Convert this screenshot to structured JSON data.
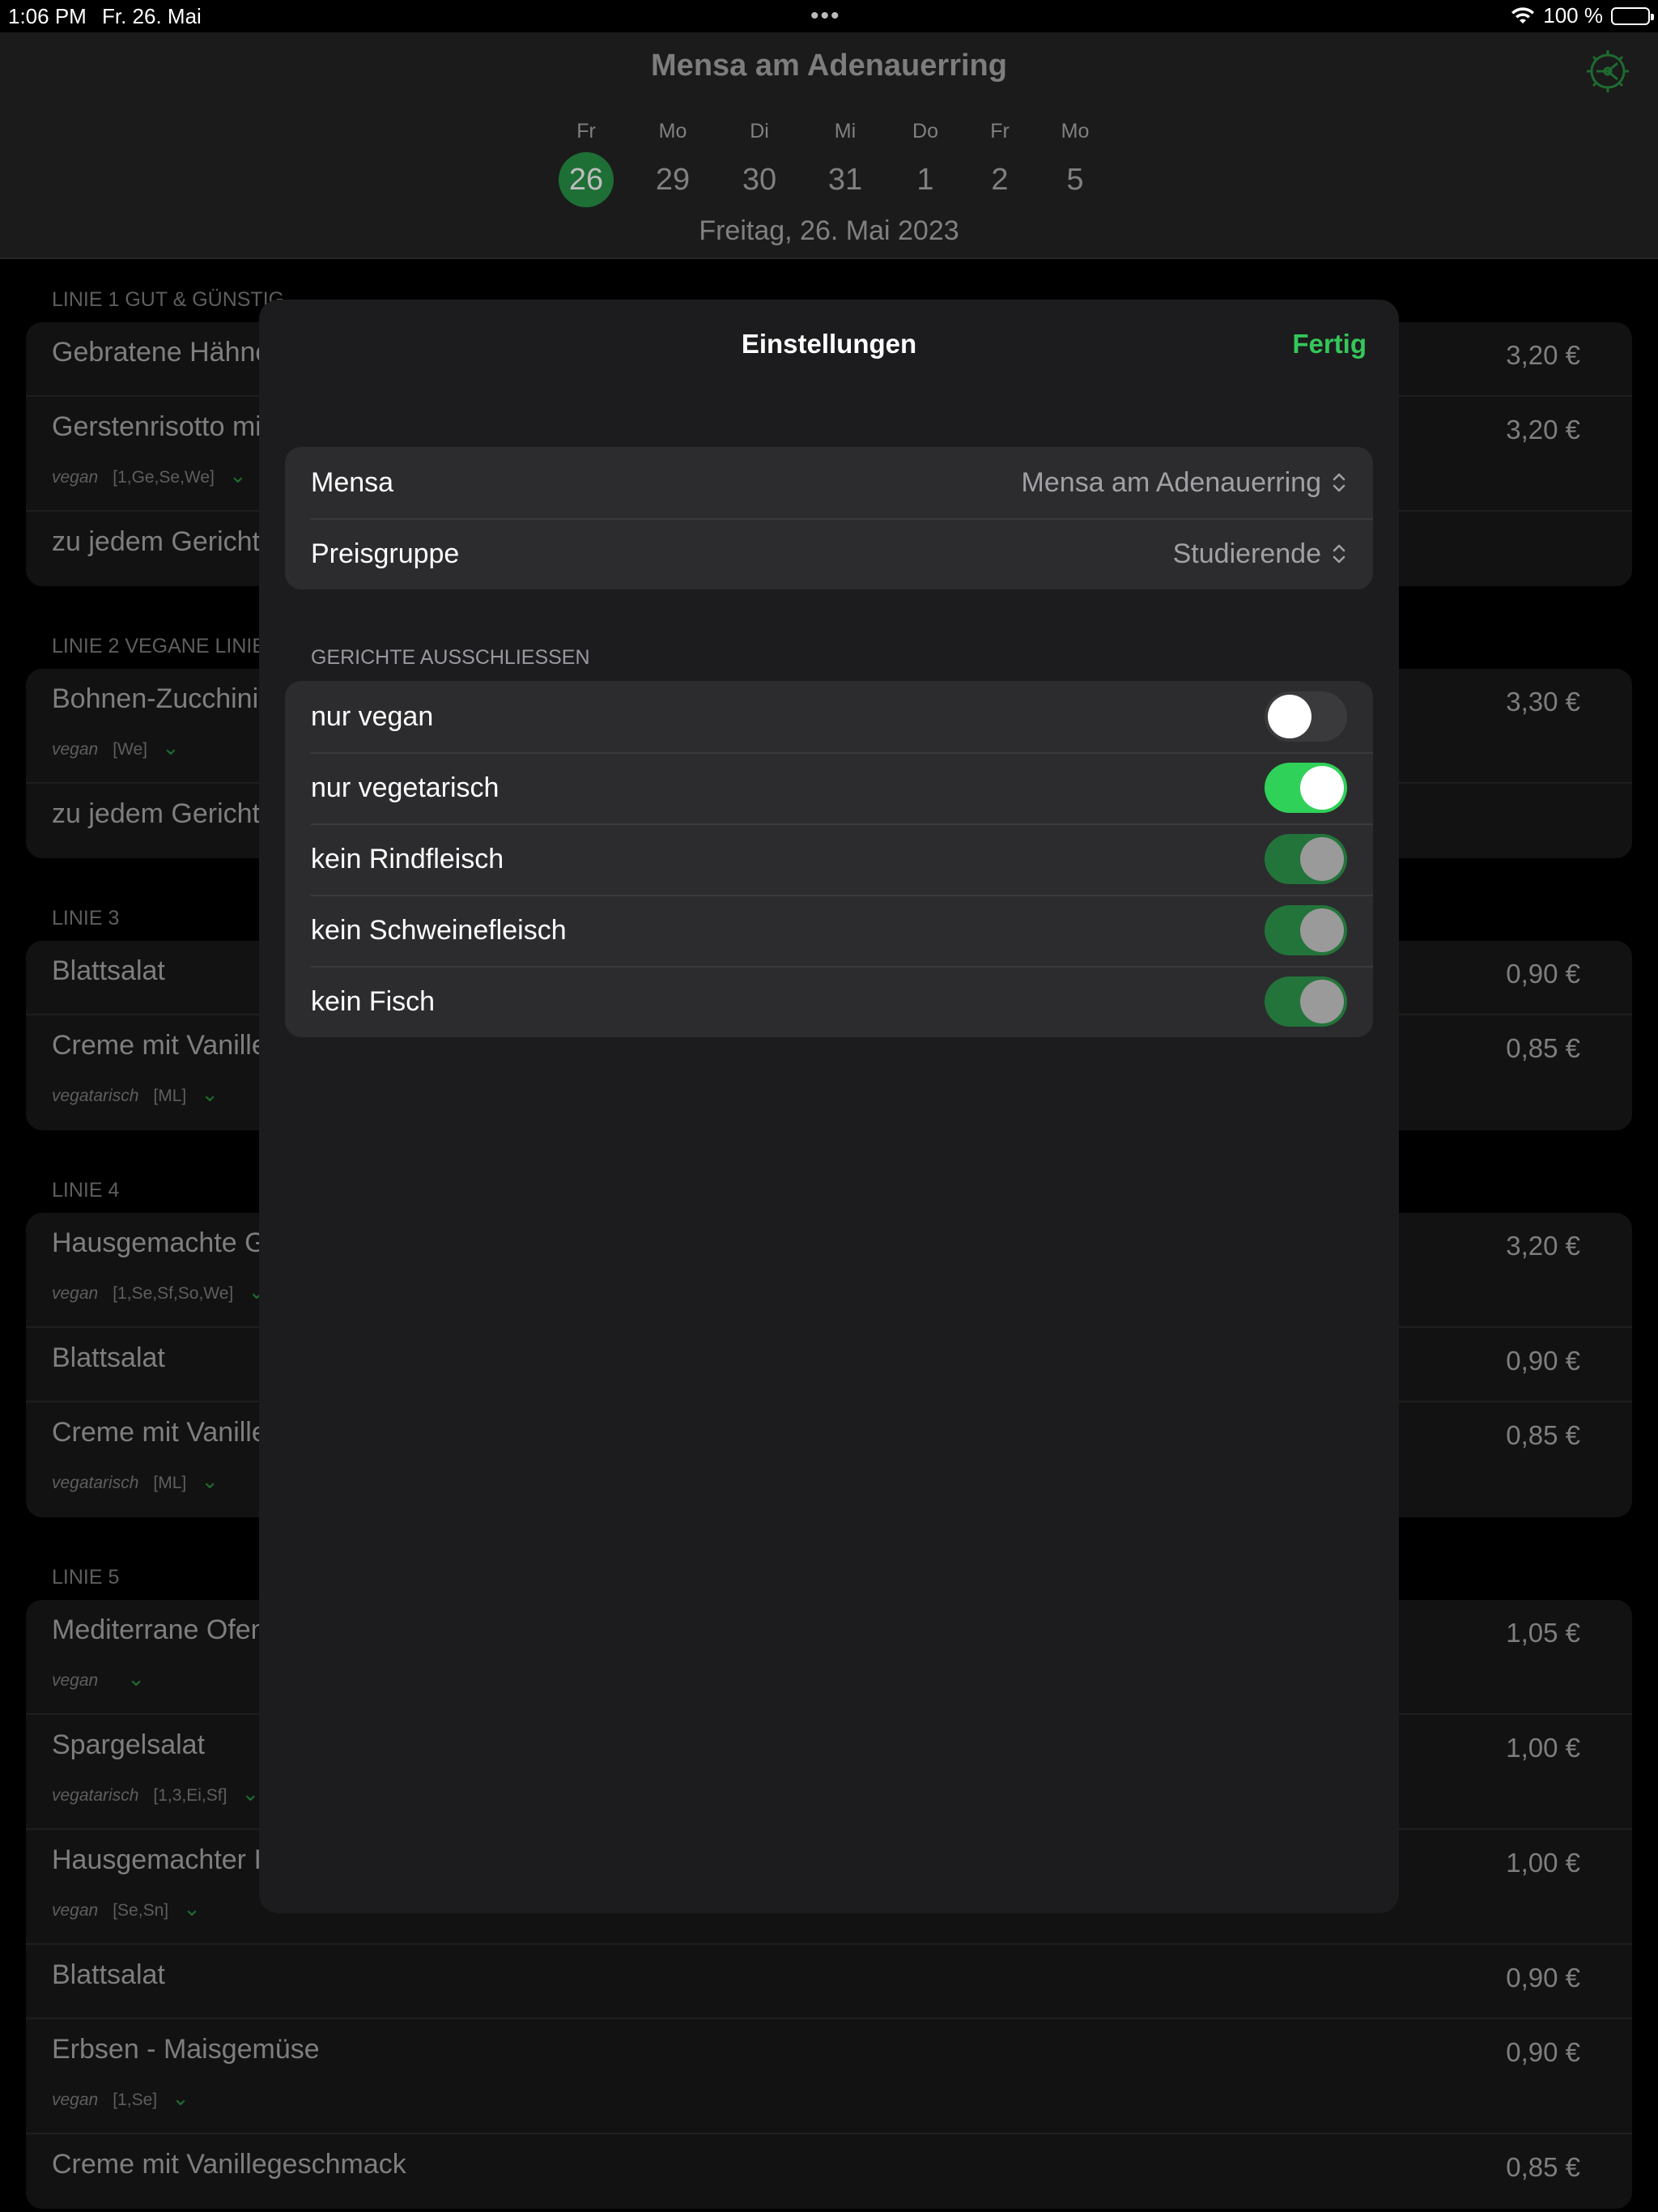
{
  "status_bar": {
    "time": "1:06 PM",
    "date": "Fr. 26. Mai",
    "dots": "•••",
    "battery": "100 %"
  },
  "header": {
    "title": "Mensa am Adenauerring",
    "full_date": "Freitag, 26. Mai 2023",
    "days": [
      {
        "wd": "Fr",
        "num": "26"
      },
      {
        "wd": "Mo",
        "num": "29"
      },
      {
        "wd": "Di",
        "num": "30"
      },
      {
        "wd": "Mi",
        "num": "31"
      },
      {
        "wd": "Do",
        "num": "1"
      },
      {
        "wd": "Fr",
        "num": "2"
      },
      {
        "wd": "Mo",
        "num": "5"
      }
    ]
  },
  "menu": {
    "sections": [
      {
        "title": "LINIE 1 GUT & GÜNSTIG",
        "items": [
          {
            "name": "Gebratene Hähnchen",
            "price": "3,20 €"
          },
          {
            "name": "Gerstenrisotto mit",
            "price": "3,20 €",
            "tag": "vegan",
            "codes": "[1,Ge,Se,We]"
          },
          {
            "name": "zu jedem Gericht"
          }
        ]
      },
      {
        "title": "LINIE 2 VEGANE LINIE",
        "items": [
          {
            "name": "Bohnen-Zucchini",
            "price": "3,30 €",
            "tag": "vegan",
            "codes": "[We]"
          },
          {
            "name": "zu jedem Gericht"
          }
        ]
      },
      {
        "title": "LINIE 3",
        "items": [
          {
            "name": "Blattsalat",
            "price": "0,90 €"
          },
          {
            "name": "Creme mit Vanille",
            "price": "0,85 €",
            "tag": "vegatarisch",
            "codes": "[ML]"
          }
        ]
      },
      {
        "title": "LINIE 4",
        "items": [
          {
            "name": "Hausgemachte G",
            "price": "3,20 €",
            "tag": "vegan",
            "codes": "[1,Se,Sf,So,We]"
          },
          {
            "name": "Blattsalat",
            "price": "0,90 €"
          },
          {
            "name": "Creme mit Vanille",
            "price": "0,85 €",
            "tag": "vegatarisch",
            "codes": "[ML]"
          }
        ]
      },
      {
        "title": "LINIE 5",
        "items": [
          {
            "name": "Mediterrane Ofen",
            "price": "1,05 €",
            "tag": "vegan",
            "codes": ""
          },
          {
            "name": "Spargelsalat",
            "price": "1,00 €",
            "tag": "vegatarisch",
            "codes": "[1,3,Ei,Sf]"
          },
          {
            "name": "Hausgemachter I",
            "price": "1,00 €",
            "tag": "vegan",
            "codes": "[Se,Sn]"
          },
          {
            "name": "Blattsalat",
            "price": "0,90 €"
          },
          {
            "name": "Erbsen - Maisgemüse",
            "price": "0,90 €",
            "tag": "vegan",
            "codes": "[1,Se]"
          },
          {
            "name": "Creme mit Vanillegeschmack",
            "price": "0,85 €"
          }
        ]
      }
    ]
  },
  "settings": {
    "title": "Einstellungen",
    "done_label": "Fertig",
    "mensa_label": "Mensa",
    "mensa_value": "Mensa am Adenauerring",
    "price_label": "Preisgruppe",
    "price_value": "Studierende",
    "exclude_header": "GERICHTE AUSSCHLIESSEN",
    "toggles": [
      {
        "label": "nur vegan",
        "state": "off"
      },
      {
        "label": "nur vegetarisch",
        "state": "on"
      },
      {
        "label": "kein Rindfleisch",
        "state": "disabled-on"
      },
      {
        "label": "kein Schweinefleisch",
        "state": "disabled-on"
      },
      {
        "label": "kein Fisch",
        "state": "disabled-on"
      }
    ]
  },
  "colors": {
    "accent": "#34c759",
    "selected_day": "#1e6f35",
    "modal_bg": "#1c1c1e",
    "group_bg": "#2c2c2e"
  }
}
